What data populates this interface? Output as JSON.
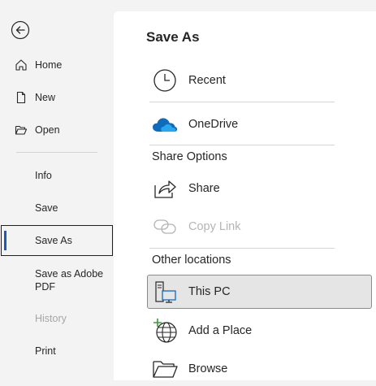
{
  "nav": {
    "items": [
      {
        "label": "Home",
        "icon": "home-icon"
      },
      {
        "label": "New",
        "icon": "new-document-icon"
      },
      {
        "label": "Open",
        "icon": "open-folder-icon"
      },
      {
        "label": "Info"
      },
      {
        "label": "Save"
      },
      {
        "label": "Save As",
        "selected": true
      },
      {
        "label": "Save as Adobe PDF"
      },
      {
        "label": "History",
        "disabled": true
      },
      {
        "label": "Print"
      }
    ]
  },
  "main": {
    "title": "Save As",
    "recent_label": "Recent",
    "onedrive_label": "OneDrive",
    "share_options_heading": "Share Options",
    "share_label": "Share",
    "copy_link_label": "Copy Link",
    "other_locations_heading": "Other locations",
    "this_pc_label": "This PC",
    "add_place_label": "Add a Place",
    "browse_label": "Browse"
  },
  "colors": {
    "accent": "#185abd",
    "onedrive_blue": "#0f6cbd",
    "add_place_green": "#3a9b3a",
    "background": "#f3f3f3",
    "panel": "#ffffff"
  }
}
